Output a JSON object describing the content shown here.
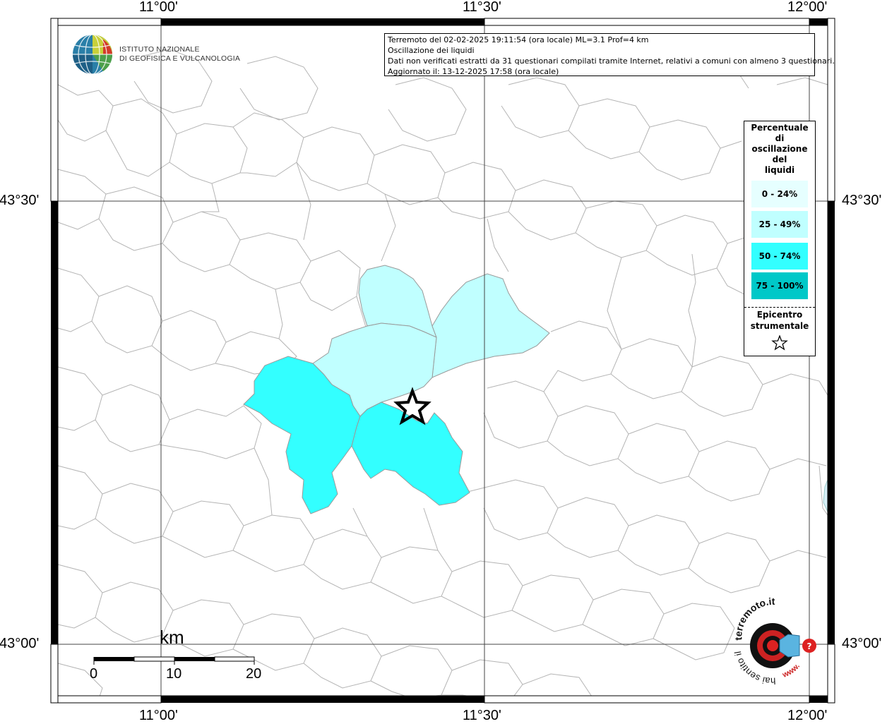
{
  "info_box": {
    "line1": "Terremoto del 02-02-2025 19:11:54 (ora locale) ML=3.1 Prof=4 km",
    "line2": "Oscillazione dei liquidi",
    "line3": "Dati non verificati estratti da 31 questionari compilati tramite Internet, relativi a comuni con almeno 3 questionari.",
    "line4": "Aggiornato il: 13-12-2025 17:58 (ora locale)"
  },
  "institute": {
    "line1": "ISTITUTO NAZIONALE",
    "line2": "DI GEOFISICA E VULCANOLOGIA"
  },
  "axes": {
    "longitude_labels": [
      "11°00'",
      "11°30'",
      "12°00'"
    ],
    "latitude_labels": [
      "43°30'",
      "43°00'"
    ]
  },
  "legend": {
    "title": "Percentuale di oscillazione del liquidi",
    "title_lines": [
      "Percentuale",
      "di",
      "oscillazione",
      "del",
      "liquidi"
    ],
    "classes": [
      {
        "label": "0 - 24%",
        "color": "#e6ffff"
      },
      {
        "label": "25 - 49%",
        "color": "#c0ffff"
      },
      {
        "label": "50 - 74%",
        "color": "#33ffff"
      },
      {
        "label": "75 - 100%",
        "color": "#00c8c8"
      }
    ],
    "epicenter_label": "Epicentro strumentale",
    "epicenter_lines": [
      "Epicentro",
      "strumentale"
    ],
    "epicenter_icon": "star-outline-icon"
  },
  "municipalities": [
    {
      "id": "north-center",
      "class": "25 - 49%",
      "color": "#c0ffff"
    },
    {
      "id": "northeast",
      "class": "25 - 49%",
      "color": "#c0ffff"
    },
    {
      "id": "center",
      "class": "25 - 49%",
      "color": "#c0ffff"
    },
    {
      "id": "southwest",
      "class": "50 - 74%",
      "color": "#33ffff"
    },
    {
      "id": "south-center",
      "class": "50 - 74%",
      "color": "#33ffff"
    }
  ],
  "scale_bar": {
    "unit": "km",
    "labels": [
      "0",
      "10",
      "20"
    ]
  },
  "watermark": {
    "text_top": "terremoto.it",
    "text_left": "hai sentito il",
    "text_bottom": "www.",
    "icon": "speaker-target-icon"
  },
  "colors": {
    "frame": "#000000",
    "border": "#b4b4b4",
    "grid": "#444444"
  }
}
